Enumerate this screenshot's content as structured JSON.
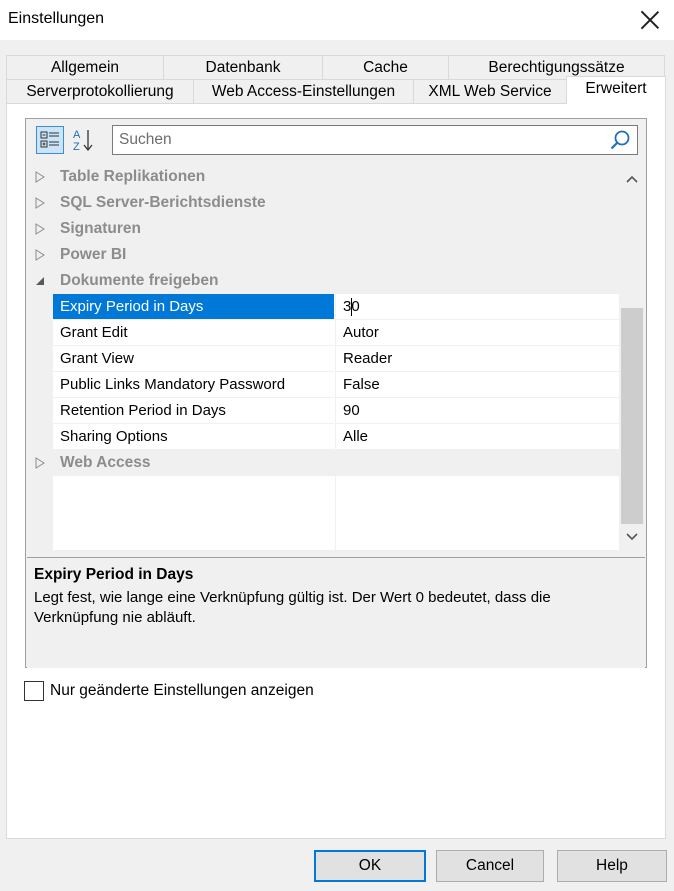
{
  "window": {
    "title": "Einstellungen"
  },
  "tabs": {
    "row1": [
      "Allgemein",
      "Datenbank",
      "Cache",
      "Berechtigungssätze"
    ],
    "row2": [
      "Serverprotokollierung",
      "Web Access-Einstellungen",
      "XML Web Service",
      "Erweitert"
    ],
    "active": "Erweitert"
  },
  "search": {
    "placeholder": "Suchen",
    "value": ""
  },
  "icons": {
    "categorized": "categorized-view-icon",
    "alphabetical": "alphabetical-sort-icon",
    "search": "search-icon"
  },
  "colors": {
    "selection": "#0078d7",
    "accent_icon": "#1e6fb8"
  },
  "categories": {
    "table_replikationen": "Table Replikationen",
    "sql_server": "SQL Server-Berichtsdienste",
    "signaturen": "Signaturen",
    "power_bi": "Power BI",
    "dokumente": "Dokumente freigeben",
    "web_access": "Web Access"
  },
  "properties": [
    {
      "name": "Expiry Period in Days",
      "value": "30"
    },
    {
      "name": "Grant Edit",
      "value": "Autor"
    },
    {
      "name": "Grant View",
      "value": "Reader"
    },
    {
      "name": "Public Links Mandatory Password",
      "value": "False"
    },
    {
      "name": "Retention Period in Days",
      "value": "90"
    },
    {
      "name": "Sharing Options",
      "value": "Alle"
    }
  ],
  "description": {
    "title": "Expiry Period in Days",
    "text": "Legt fest, wie lange eine Verknüpfung gültig ist. Der Wert 0 bedeutet, dass die Verknüpfung nie abläuft."
  },
  "show_changed_only": {
    "label": "Nur geänderte Einstellungen anzeigen",
    "checked": false
  },
  "buttons": {
    "ok": "OK",
    "cancel": "Cancel",
    "help": "Help"
  }
}
